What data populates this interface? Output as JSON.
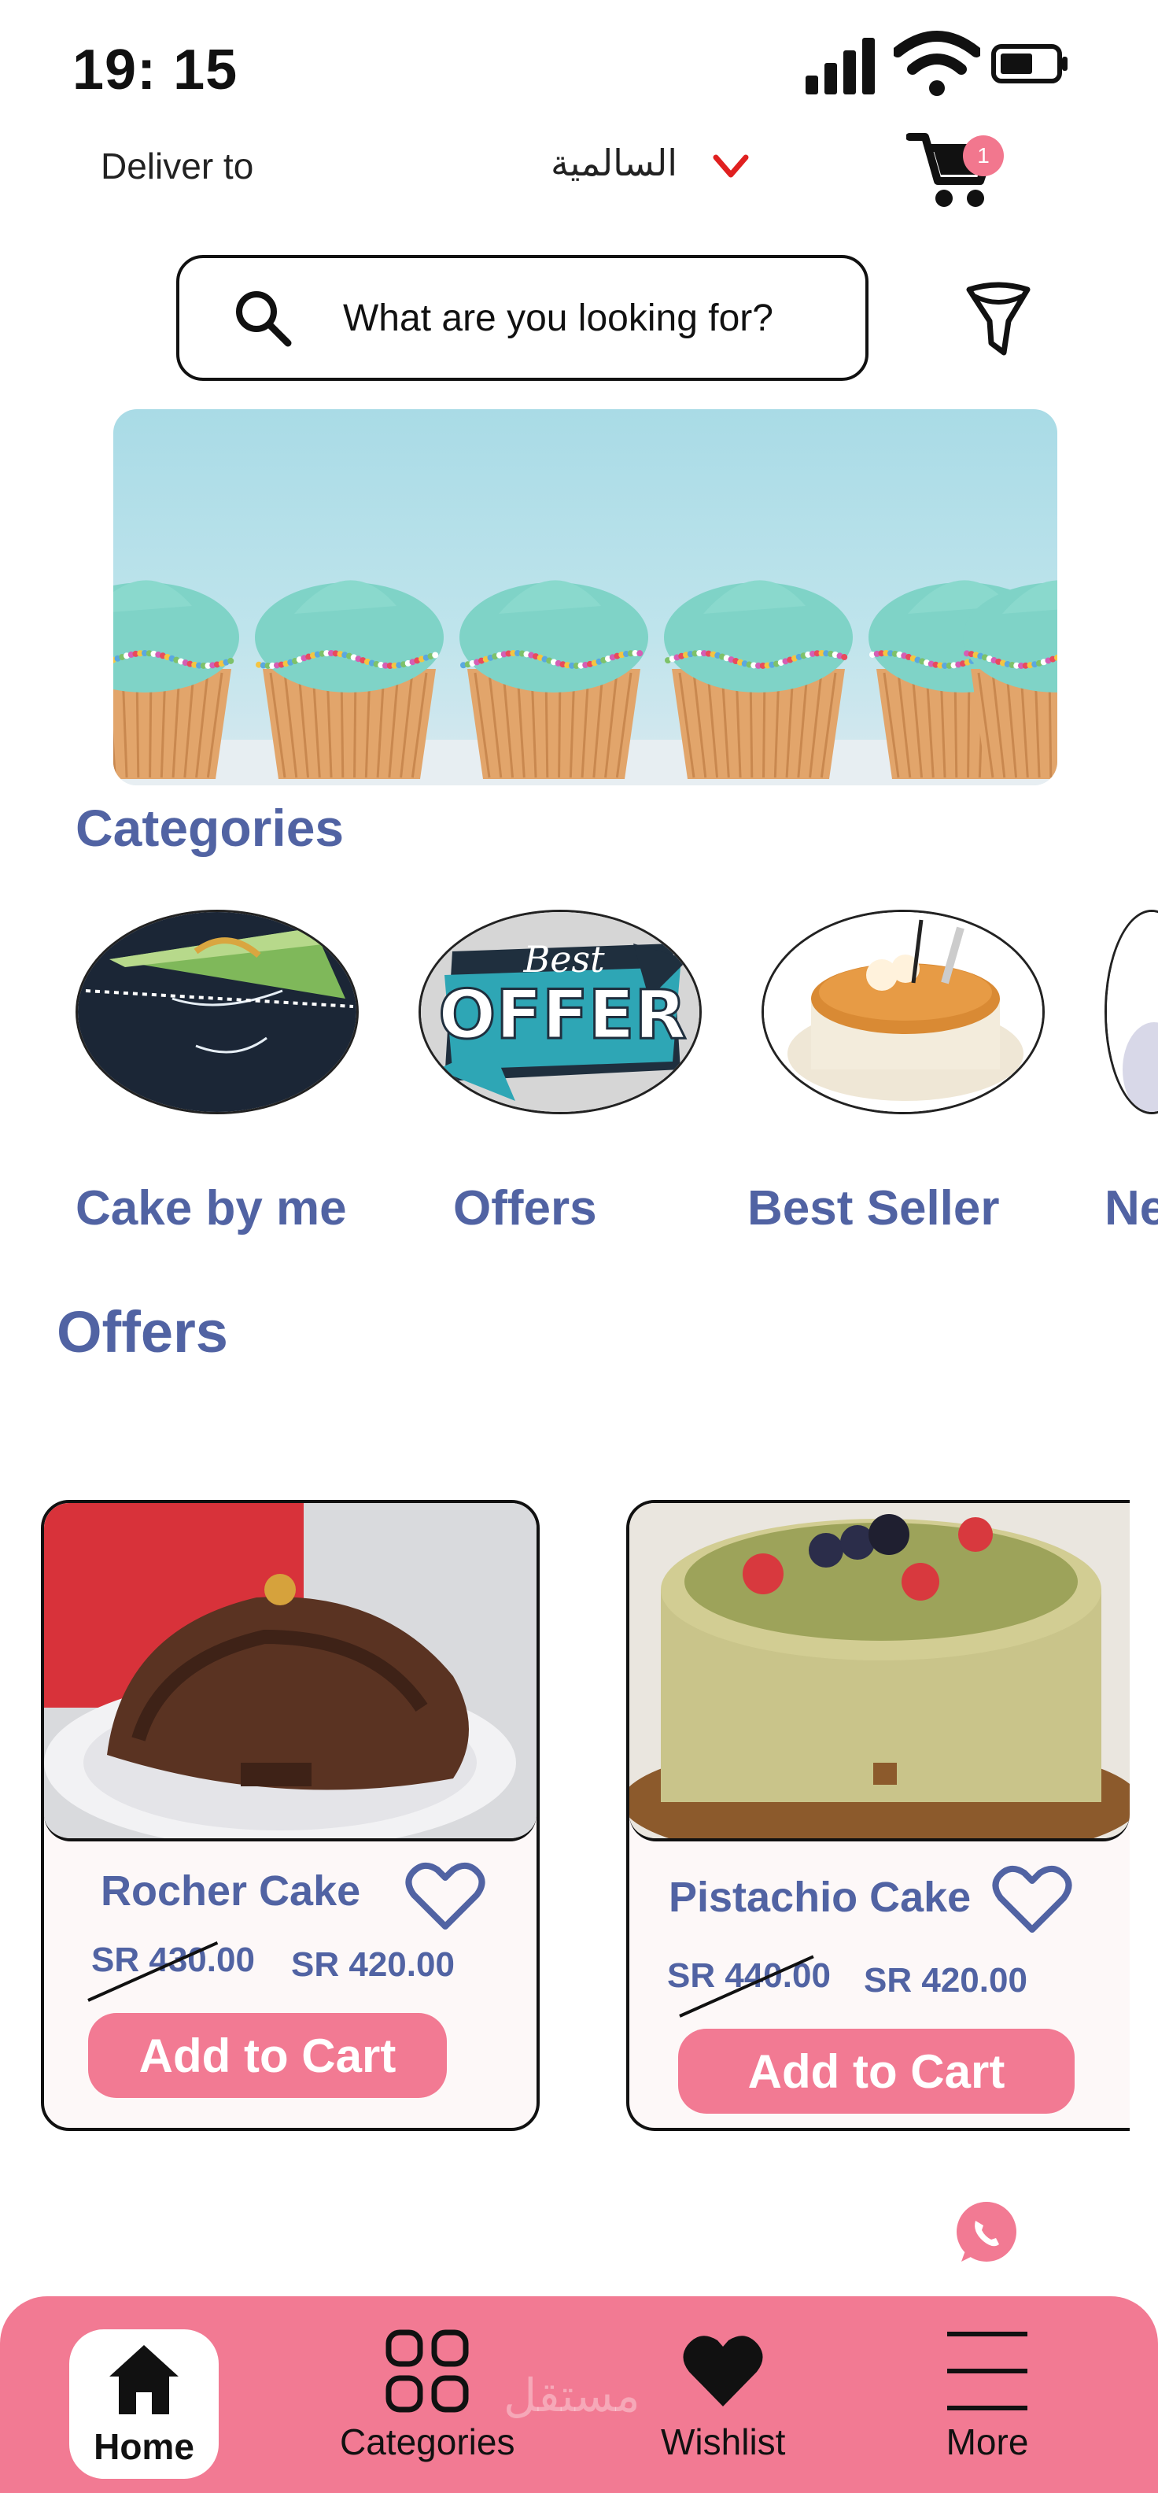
{
  "status_bar": {
    "time": "19: 15"
  },
  "deliver": {
    "label": "Deliver to",
    "city": "السالمية"
  },
  "cart": {
    "badge": "1"
  },
  "search": {
    "placeholder": "What are you looking for?"
  },
  "categories": {
    "title": "Categories",
    "items": [
      {
        "label": "Cake by me"
      },
      {
        "label": "Offers"
      },
      {
        "label": "Best Seller"
      },
      {
        "label": "Ne"
      }
    ]
  },
  "offer_badge": {
    "top": "Best",
    "bottom": "OFFER"
  },
  "offers": {
    "title": "Offers",
    "items": [
      {
        "name": "Rocher Cake",
        "old_price": "SR 430.00",
        "new_price": "SR 420.00",
        "button": "Add to Cart"
      },
      {
        "name": "Pistachio Cake",
        "old_price": "SR 440.00",
        "new_price": "SR 420.00",
        "button": "Add to Cart"
      }
    ]
  },
  "bottom_nav": {
    "items": [
      {
        "label": "Home"
      },
      {
        "label": "Categories"
      },
      {
        "label": "Wishlist"
      },
      {
        "label": "More"
      }
    ]
  },
  "watermark": "مستقل",
  "colors": {
    "accent": "#f27a93",
    "heading": "#5163a3",
    "ink": "#111111"
  }
}
